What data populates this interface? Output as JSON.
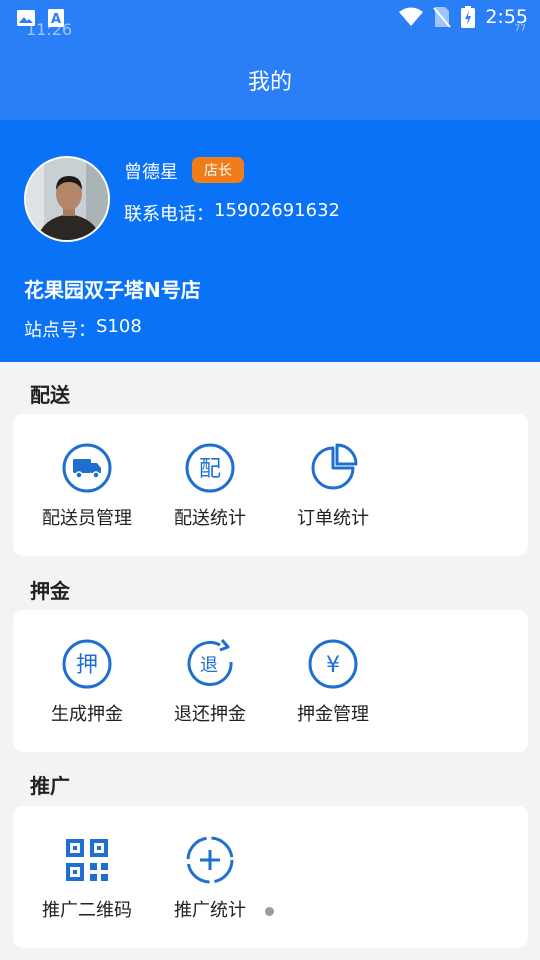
{
  "status_bar": {
    "time_ghost": "11:26",
    "clock": "2:55",
    "battery_ghost": "77"
  },
  "header": {
    "title": "我的"
  },
  "profile": {
    "name": "曾德星",
    "role_badge": "店长",
    "phone_label": "联系电话：",
    "phone": "15902691632",
    "store_name": "花果园双子塔N号店",
    "site_label": "站点号：",
    "site_no": "S108"
  },
  "sections": {
    "delivery": {
      "title": "配送",
      "items": [
        {
          "label": "配送员管理",
          "icon": "delivery-truck-icon"
        },
        {
          "label": "配送统计",
          "icon": "delivery-stats-icon",
          "glyph": "配"
        },
        {
          "label": "订单统计",
          "icon": "pie-chart-icon"
        }
      ]
    },
    "deposit": {
      "title": "押金",
      "items": [
        {
          "label": "生成押金",
          "icon": "create-deposit-icon",
          "glyph": "押"
        },
        {
          "label": "退还押金",
          "icon": "refund-deposit-icon",
          "glyph": "退"
        },
        {
          "label": "押金管理",
          "icon": "deposit-manage-icon",
          "glyph": "¥"
        }
      ]
    },
    "promotion": {
      "title": "推广",
      "items": [
        {
          "label": "推广二维码",
          "icon": "qr-code-icon"
        },
        {
          "label": "推广统计",
          "icon": "promotion-stats-icon"
        }
      ]
    }
  },
  "colors": {
    "primary": "#0a72f6",
    "header": "#2b7ff6",
    "icon": "#1f6fd1",
    "badge": "#f07c1a",
    "background": "#f2f3f5"
  }
}
